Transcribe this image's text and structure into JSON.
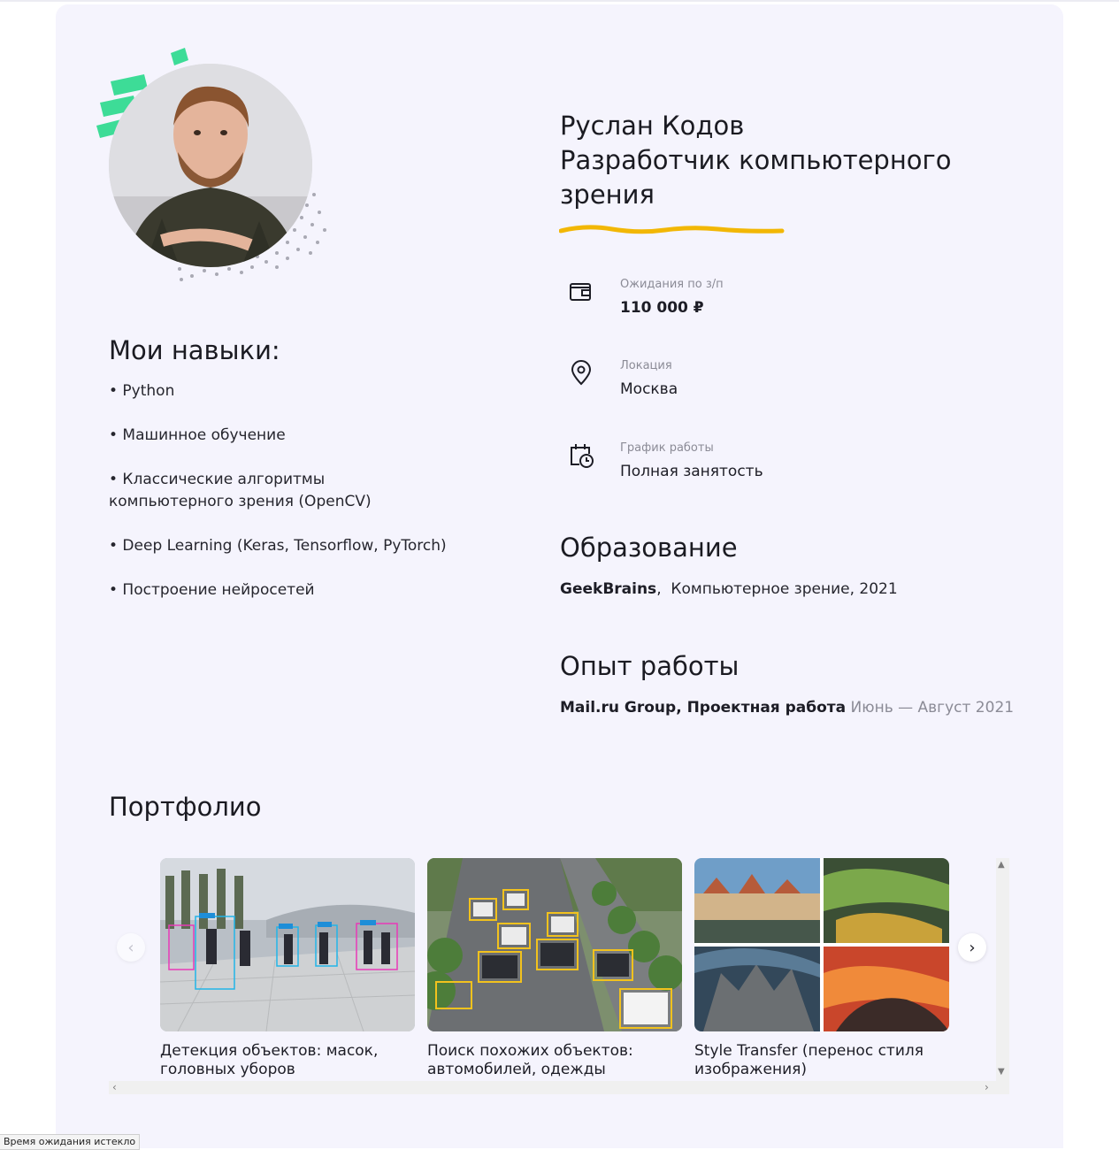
{
  "profile": {
    "name": "Руслан Кодов",
    "role_line1": "Разработчик компьютерного",
    "role_line2": "зрения"
  },
  "info": [
    {
      "label": "Ожидания по з/п",
      "value": "110 000 ₽",
      "icon": "wallet-icon"
    },
    {
      "label": "Локация",
      "value": "Москва",
      "icon": "location-pin-icon"
    },
    {
      "label": "График работы",
      "value": "Полная занятость",
      "icon": "calendar-clock-icon"
    }
  ],
  "skills": {
    "title": "Мои навыки:",
    "items": [
      "• Python",
      "• Машинное обучение",
      "• Классические алгоритмы компьютерного зрения (OpenCV)",
      "• Deep Learning (Keras, Tensorflow, PyTorch)",
      "• Построение нейросетей"
    ]
  },
  "education": {
    "title": "Образование",
    "school": "GeekBrains",
    "separator": ",",
    "details": "Компьютерное зрение, 2021"
  },
  "experience": {
    "title": "Опыт работы",
    "company": "Mail.ru Group, Проектная работа",
    "period": "Июнь — Август 2021"
  },
  "portfolio": {
    "title": "Портфолио",
    "items": [
      {
        "caption": "Детекция объектов: масок, головных уборов"
      },
      {
        "caption": "Поиск похожих объектов: автомобилей, одежды"
      },
      {
        "caption": "Style Transfer (перенос стиля изображения)"
      }
    ],
    "prev_arrow": "‹",
    "next_arrow": "›"
  },
  "status_bar": {
    "text": "Время ожидания истекло"
  },
  "colors": {
    "card_bg": "#f5f4fd",
    "accent_yellow": "#f2b705",
    "accent_green": "#3ddc97",
    "muted_text": "#8b8b96"
  }
}
